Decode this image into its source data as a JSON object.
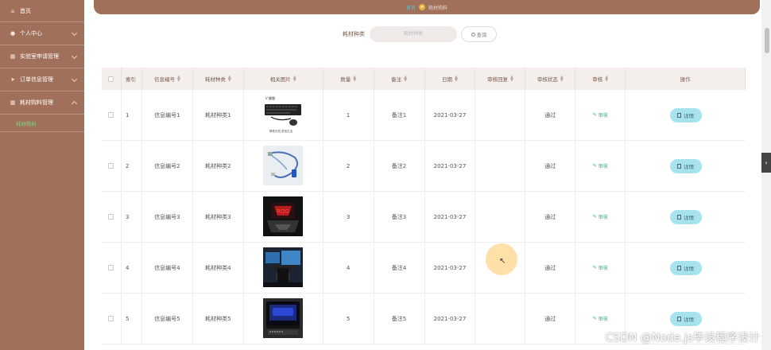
{
  "sidebar": {
    "items": [
      {
        "label": "首页",
        "icon": "home-icon"
      },
      {
        "label": "个人中心",
        "icon": "user-icon"
      },
      {
        "label": "实验室申请管理",
        "icon": "grid-icon"
      },
      {
        "label": "订单信息管理",
        "icon": "send-icon"
      },
      {
        "label": "耗材购料管理",
        "icon": "grid-icon"
      }
    ],
    "sub_item": "耗材购料"
  },
  "breadcrumb": {
    "home": "首页",
    "current": "耗材购料"
  },
  "search": {
    "label": "耗材种类",
    "placeholder": "耗材种类",
    "button": "查询"
  },
  "table": {
    "headers": [
      "索引",
      "信息编号",
      "耗材种类",
      "相关图片",
      "数量",
      "备注",
      "日期",
      "审核回复",
      "审核状态",
      "审核",
      "操作"
    ],
    "rows": [
      {
        "index": "1",
        "code": "信息编号1",
        "type": "耗材种类1",
        "qty": "1",
        "note": "备注1",
        "date": "2021-03-27",
        "reply": "",
        "status": "通过",
        "audit": "审核",
        "action": "详情",
        "image": "keyboard-mouse"
      },
      {
        "index": "2",
        "code": "信息编号2",
        "type": "耗材种类2",
        "qty": "2",
        "note": "备注2",
        "date": "2021-03-27",
        "reply": "",
        "status": "通过",
        "audit": "审核",
        "action": "详情",
        "image": "usb-cable"
      },
      {
        "index": "3",
        "code": "信息编号3",
        "type": "耗材种类3",
        "qty": "3",
        "note": "备注3",
        "date": "2021-03-27",
        "reply": "",
        "status": "通过",
        "audit": "审核",
        "action": "详情",
        "image": "gaming-logo"
      },
      {
        "index": "4",
        "code": "信息编号4",
        "type": "耗材种类4",
        "qty": "4",
        "note": "备注4",
        "date": "2021-03-27",
        "reply": "",
        "status": "通过",
        "audit": "审核",
        "action": "详情",
        "image": "gaming-setup"
      },
      {
        "index": "5",
        "code": "信息编号5",
        "type": "耗材种类5",
        "qty": "5",
        "note": "备注5",
        "date": "2021-03-27",
        "reply": "",
        "status": "通过",
        "audit": "审核",
        "action": "详情",
        "image": "monitor"
      }
    ]
  },
  "watermark": "CSDN @Node.js毕设程序设计",
  "colors": {
    "sidebar": "#a0705a",
    "accent": "#a6e3ec",
    "sub_active": "#7cd67c",
    "audit": "#2bb673"
  }
}
